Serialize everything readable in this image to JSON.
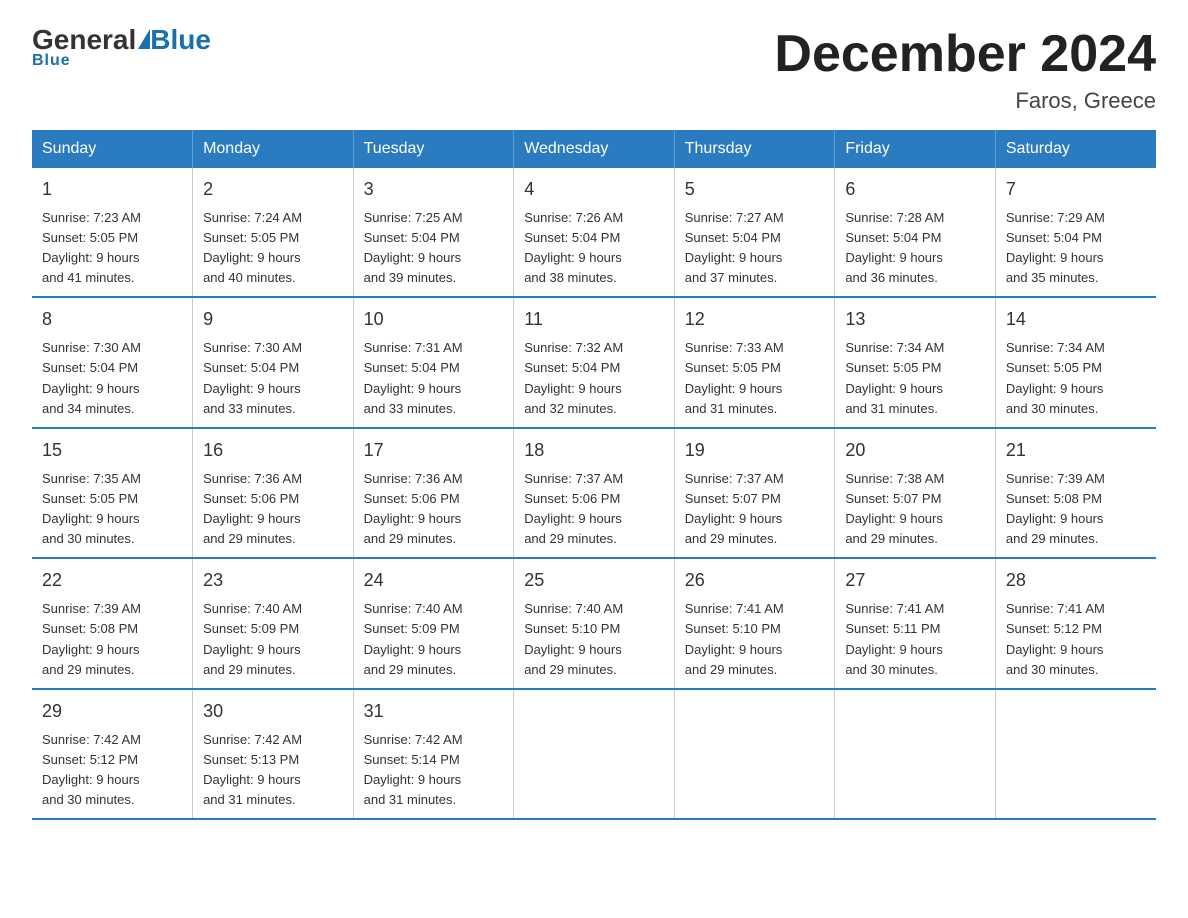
{
  "logo": {
    "general": "General",
    "blue": "Blue"
  },
  "title": "December 2024",
  "subtitle": "Faros, Greece",
  "days_header": [
    "Sunday",
    "Monday",
    "Tuesday",
    "Wednesday",
    "Thursday",
    "Friday",
    "Saturday"
  ],
  "weeks": [
    [
      {
        "day": "1",
        "sunrise": "7:23 AM",
        "sunset": "5:05 PM",
        "daylight": "9 hours and 41 minutes."
      },
      {
        "day": "2",
        "sunrise": "7:24 AM",
        "sunset": "5:05 PM",
        "daylight": "9 hours and 40 minutes."
      },
      {
        "day": "3",
        "sunrise": "7:25 AM",
        "sunset": "5:04 PM",
        "daylight": "9 hours and 39 minutes."
      },
      {
        "day": "4",
        "sunrise": "7:26 AM",
        "sunset": "5:04 PM",
        "daylight": "9 hours and 38 minutes."
      },
      {
        "day": "5",
        "sunrise": "7:27 AM",
        "sunset": "5:04 PM",
        "daylight": "9 hours and 37 minutes."
      },
      {
        "day": "6",
        "sunrise": "7:28 AM",
        "sunset": "5:04 PM",
        "daylight": "9 hours and 36 minutes."
      },
      {
        "day": "7",
        "sunrise": "7:29 AM",
        "sunset": "5:04 PM",
        "daylight": "9 hours and 35 minutes."
      }
    ],
    [
      {
        "day": "8",
        "sunrise": "7:30 AM",
        "sunset": "5:04 PM",
        "daylight": "9 hours and 34 minutes."
      },
      {
        "day": "9",
        "sunrise": "7:30 AM",
        "sunset": "5:04 PM",
        "daylight": "9 hours and 33 minutes."
      },
      {
        "day": "10",
        "sunrise": "7:31 AM",
        "sunset": "5:04 PM",
        "daylight": "9 hours and 33 minutes."
      },
      {
        "day": "11",
        "sunrise": "7:32 AM",
        "sunset": "5:04 PM",
        "daylight": "9 hours and 32 minutes."
      },
      {
        "day": "12",
        "sunrise": "7:33 AM",
        "sunset": "5:05 PM",
        "daylight": "9 hours and 31 minutes."
      },
      {
        "day": "13",
        "sunrise": "7:34 AM",
        "sunset": "5:05 PM",
        "daylight": "9 hours and 31 minutes."
      },
      {
        "day": "14",
        "sunrise": "7:34 AM",
        "sunset": "5:05 PM",
        "daylight": "9 hours and 30 minutes."
      }
    ],
    [
      {
        "day": "15",
        "sunrise": "7:35 AM",
        "sunset": "5:05 PM",
        "daylight": "9 hours and 30 minutes."
      },
      {
        "day": "16",
        "sunrise": "7:36 AM",
        "sunset": "5:06 PM",
        "daylight": "9 hours and 29 minutes."
      },
      {
        "day": "17",
        "sunrise": "7:36 AM",
        "sunset": "5:06 PM",
        "daylight": "9 hours and 29 minutes."
      },
      {
        "day": "18",
        "sunrise": "7:37 AM",
        "sunset": "5:06 PM",
        "daylight": "9 hours and 29 minutes."
      },
      {
        "day": "19",
        "sunrise": "7:37 AM",
        "sunset": "5:07 PM",
        "daylight": "9 hours and 29 minutes."
      },
      {
        "day": "20",
        "sunrise": "7:38 AM",
        "sunset": "5:07 PM",
        "daylight": "9 hours and 29 minutes."
      },
      {
        "day": "21",
        "sunrise": "7:39 AM",
        "sunset": "5:08 PM",
        "daylight": "9 hours and 29 minutes."
      }
    ],
    [
      {
        "day": "22",
        "sunrise": "7:39 AM",
        "sunset": "5:08 PM",
        "daylight": "9 hours and 29 minutes."
      },
      {
        "day": "23",
        "sunrise": "7:40 AM",
        "sunset": "5:09 PM",
        "daylight": "9 hours and 29 minutes."
      },
      {
        "day": "24",
        "sunrise": "7:40 AM",
        "sunset": "5:09 PM",
        "daylight": "9 hours and 29 minutes."
      },
      {
        "day": "25",
        "sunrise": "7:40 AM",
        "sunset": "5:10 PM",
        "daylight": "9 hours and 29 minutes."
      },
      {
        "day": "26",
        "sunrise": "7:41 AM",
        "sunset": "5:10 PM",
        "daylight": "9 hours and 29 minutes."
      },
      {
        "day": "27",
        "sunrise": "7:41 AM",
        "sunset": "5:11 PM",
        "daylight": "9 hours and 30 minutes."
      },
      {
        "day": "28",
        "sunrise": "7:41 AM",
        "sunset": "5:12 PM",
        "daylight": "9 hours and 30 minutes."
      }
    ],
    [
      {
        "day": "29",
        "sunrise": "7:42 AM",
        "sunset": "5:12 PM",
        "daylight": "9 hours and 30 minutes."
      },
      {
        "day": "30",
        "sunrise": "7:42 AM",
        "sunset": "5:13 PM",
        "daylight": "9 hours and 31 minutes."
      },
      {
        "day": "31",
        "sunrise": "7:42 AM",
        "sunset": "5:14 PM",
        "daylight": "9 hours and 31 minutes."
      },
      {
        "day": "",
        "sunrise": "",
        "sunset": "",
        "daylight": ""
      },
      {
        "day": "",
        "sunrise": "",
        "sunset": "",
        "daylight": ""
      },
      {
        "day": "",
        "sunrise": "",
        "sunset": "",
        "daylight": ""
      },
      {
        "day": "",
        "sunrise": "",
        "sunset": "",
        "daylight": ""
      }
    ]
  ],
  "labels": {
    "sunrise": "Sunrise:",
    "sunset": "Sunset:",
    "daylight": "Daylight:"
  }
}
